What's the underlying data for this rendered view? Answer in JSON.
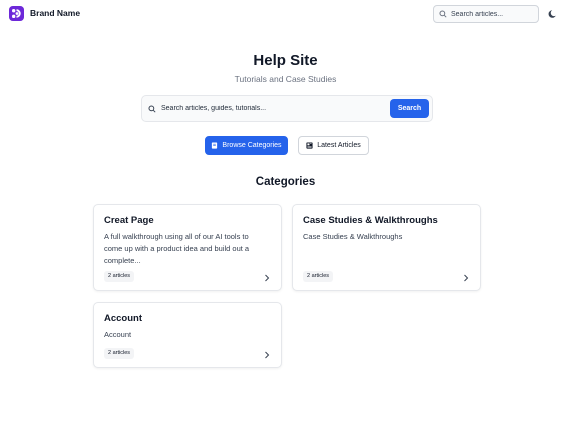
{
  "header": {
    "brand_name": "Brand Name",
    "search_placeholder": "Search articles...",
    "theme_icon": "moon-icon",
    "accent": "#6d28d9"
  },
  "hero": {
    "title": "Help Site",
    "subtitle": "Tutorials and Case Studies",
    "search_placeholder": "Search articles, guides, tutorials...",
    "search_button": "Search",
    "browse_button": "Browse Categories",
    "latest_button": "Latest Articles",
    "button_color": "#2563eb"
  },
  "categories": {
    "heading": "Categories",
    "items": [
      {
        "title": "Creat Page",
        "description": "A full walkthrough using all of our AI tools to come up with a product idea and build out a complete...",
        "badge": "2 articles"
      },
      {
        "title": "Case Studies & Walkthroughs",
        "description": "Case Studies & Walkthroughs",
        "badge": "2 articles"
      },
      {
        "title": "Account",
        "description": "Account",
        "badge": "2 articles"
      }
    ]
  }
}
